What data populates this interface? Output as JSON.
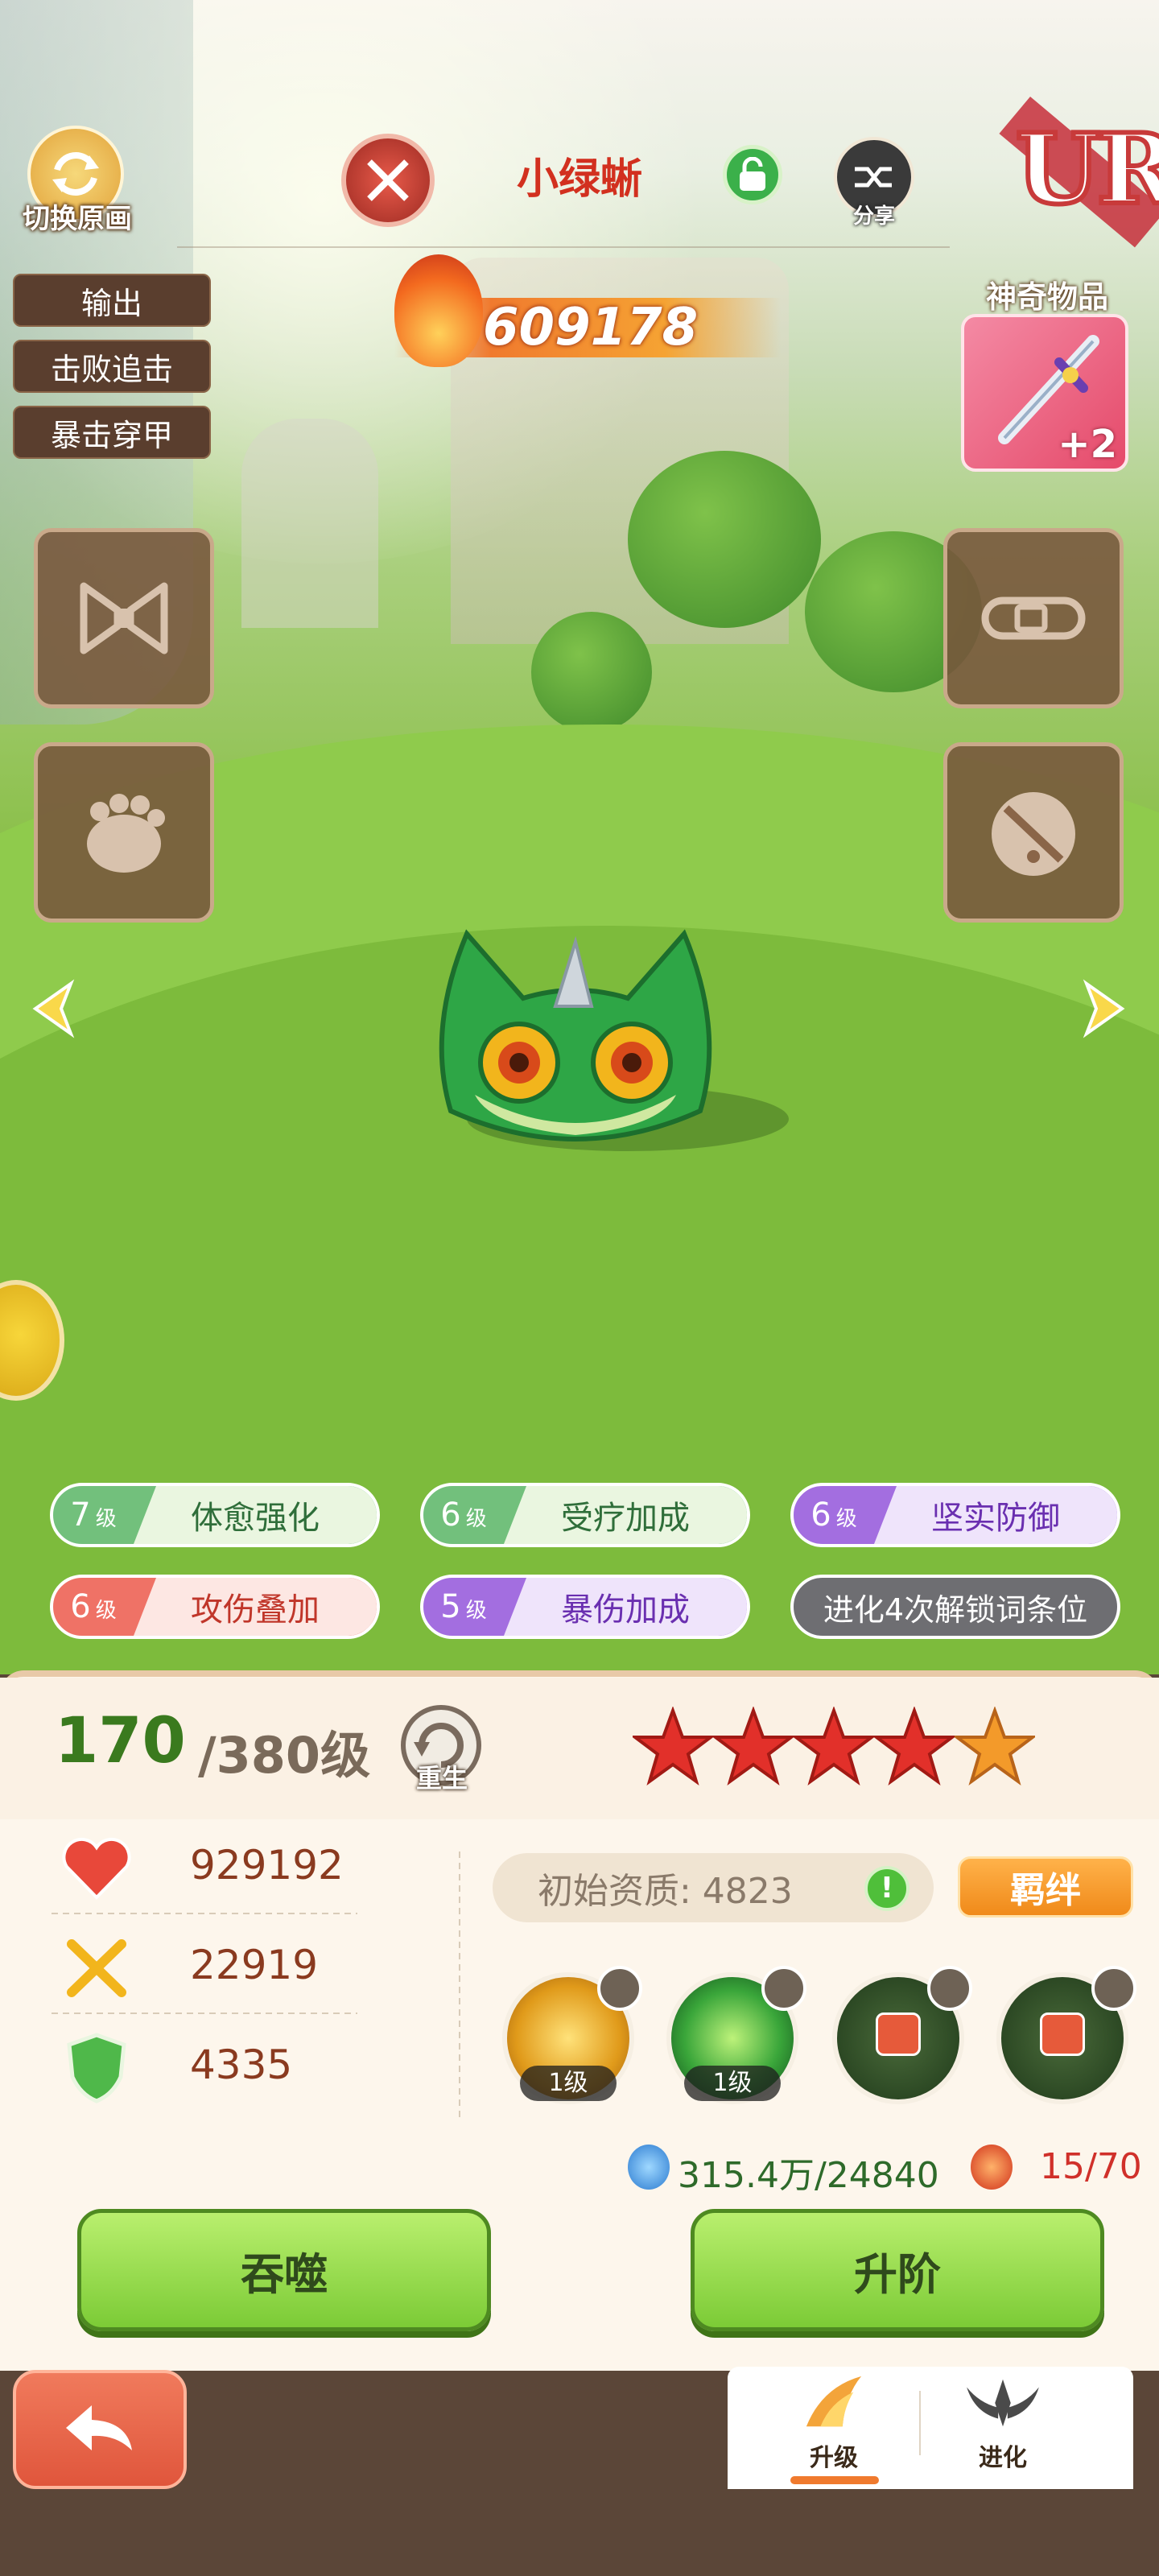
{
  "header": {
    "switch_label": "切换原画",
    "pet_name": "小绿蜥",
    "share_label": "分享",
    "rarity": "UR",
    "power": "609178"
  },
  "tags": [
    "输出",
    "击败追击",
    "暴击穿甲"
  ],
  "artifact": {
    "label": "神奇物品",
    "plus": "+2"
  },
  "traits": [
    {
      "level": "7",
      "unit": "级",
      "name": "体愈强化",
      "color": "green"
    },
    {
      "level": "6",
      "unit": "级",
      "name": "受疗加成",
      "color": "green"
    },
    {
      "level": "6",
      "unit": "级",
      "name": "坚实防御",
      "color": "purple"
    },
    {
      "level": "6",
      "unit": "级",
      "name": "攻伤叠加",
      "color": "red"
    },
    {
      "level": "5",
      "unit": "级",
      "name": "暴伤加成",
      "color": "purple"
    }
  ],
  "trait_locked": "进化4次解锁词条位",
  "level": {
    "current": "170",
    "max": "/380级",
    "rebirth_label": "重生",
    "stars": 5
  },
  "stats": {
    "hp": "929192",
    "attack": "22919",
    "defense": "4335"
  },
  "aptitude": "初始资质: 4823",
  "bond_label": "羁绊",
  "skills": [
    {
      "tag": "1级",
      "locked": false,
      "icon": "gold-skill-icon"
    },
    {
      "tag": "1级",
      "locked": false,
      "icon": "green-skill-icon"
    },
    {
      "tag": "",
      "locked": true,
      "icon": "locked-skill-icon"
    },
    {
      "tag": "",
      "locked": true,
      "icon": "locked-skill-icon"
    }
  ],
  "resources": {
    "potion": "315.4万/24840",
    "fragments": "15/70"
  },
  "buttons": {
    "devour": "吞噬",
    "ascend": "升阶"
  },
  "nav": {
    "upgrade": "升级",
    "evolve": "进化"
  },
  "colors": {
    "accent": "#f07a2e",
    "button_green": "#7ccb36",
    "name_red": "#d2301f"
  }
}
